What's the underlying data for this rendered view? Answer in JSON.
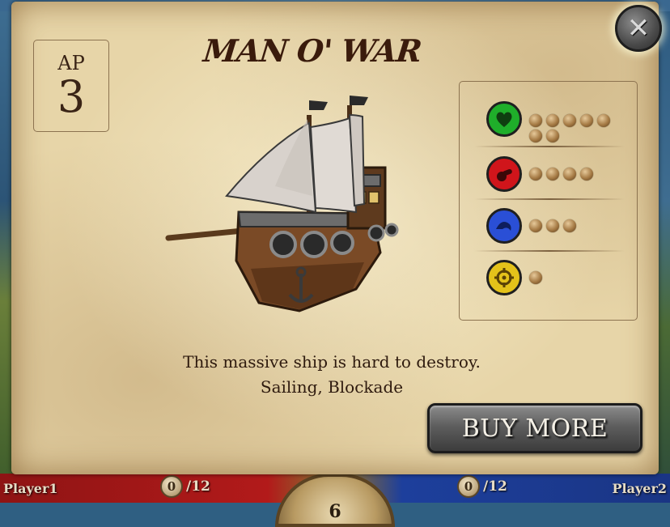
{
  "card": {
    "title": "MAN O' WAR",
    "ap_label": "AP",
    "ap_value": "3",
    "description_line1": "This massive ship is hard to destroy.",
    "description_line2": "Sailing, Blockade",
    "buy_button_label": "BUY MORE",
    "close_icon": "close-x-icon"
  },
  "stats": [
    {
      "name": "health",
      "icon": "heart-icon",
      "color": "#1fae2a",
      "level": 7
    },
    {
      "name": "attack",
      "icon": "cannon-icon",
      "color": "#d0151b",
      "level": 4
    },
    {
      "name": "movement",
      "icon": "wave-icon",
      "color": "#2a4fd6",
      "level": 3
    },
    {
      "name": "range",
      "icon": "crosshair-icon",
      "color": "#e4c21a",
      "level": 1
    }
  ],
  "hud": {
    "player1_name": "Player1",
    "player1_score": "0",
    "player1_max": "/12",
    "player2_name": "Player2",
    "player2_score": "0",
    "player2_max": "/12",
    "turn": "6"
  }
}
